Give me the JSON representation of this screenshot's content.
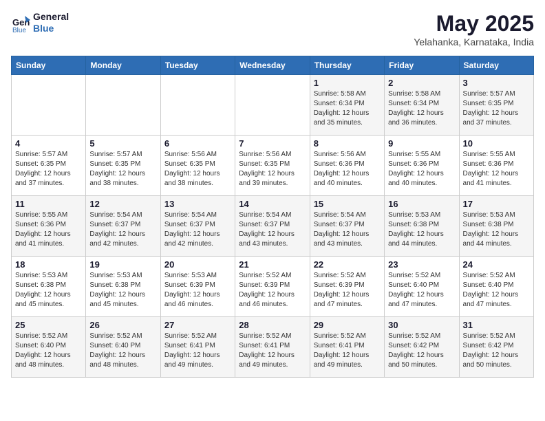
{
  "header": {
    "logo_line1": "General",
    "logo_line2": "Blue",
    "month_title": "May 2025",
    "subtitle": "Yelahanka, Karnataka, India"
  },
  "weekdays": [
    "Sunday",
    "Monday",
    "Tuesday",
    "Wednesday",
    "Thursday",
    "Friday",
    "Saturday"
  ],
  "weeks": [
    [
      {
        "day": "",
        "info": ""
      },
      {
        "day": "",
        "info": ""
      },
      {
        "day": "",
        "info": ""
      },
      {
        "day": "",
        "info": ""
      },
      {
        "day": "1",
        "info": "Sunrise: 5:58 AM\nSunset: 6:34 PM\nDaylight: 12 hours\nand 35 minutes."
      },
      {
        "day": "2",
        "info": "Sunrise: 5:58 AM\nSunset: 6:34 PM\nDaylight: 12 hours\nand 36 minutes."
      },
      {
        "day": "3",
        "info": "Sunrise: 5:57 AM\nSunset: 6:35 PM\nDaylight: 12 hours\nand 37 minutes."
      }
    ],
    [
      {
        "day": "4",
        "info": "Sunrise: 5:57 AM\nSunset: 6:35 PM\nDaylight: 12 hours\nand 37 minutes."
      },
      {
        "day": "5",
        "info": "Sunrise: 5:57 AM\nSunset: 6:35 PM\nDaylight: 12 hours\nand 38 minutes."
      },
      {
        "day": "6",
        "info": "Sunrise: 5:56 AM\nSunset: 6:35 PM\nDaylight: 12 hours\nand 38 minutes."
      },
      {
        "day": "7",
        "info": "Sunrise: 5:56 AM\nSunset: 6:35 PM\nDaylight: 12 hours\nand 39 minutes."
      },
      {
        "day": "8",
        "info": "Sunrise: 5:56 AM\nSunset: 6:36 PM\nDaylight: 12 hours\nand 40 minutes."
      },
      {
        "day": "9",
        "info": "Sunrise: 5:55 AM\nSunset: 6:36 PM\nDaylight: 12 hours\nand 40 minutes."
      },
      {
        "day": "10",
        "info": "Sunrise: 5:55 AM\nSunset: 6:36 PM\nDaylight: 12 hours\nand 41 minutes."
      }
    ],
    [
      {
        "day": "11",
        "info": "Sunrise: 5:55 AM\nSunset: 6:36 PM\nDaylight: 12 hours\nand 41 minutes."
      },
      {
        "day": "12",
        "info": "Sunrise: 5:54 AM\nSunset: 6:37 PM\nDaylight: 12 hours\nand 42 minutes."
      },
      {
        "day": "13",
        "info": "Sunrise: 5:54 AM\nSunset: 6:37 PM\nDaylight: 12 hours\nand 42 minutes."
      },
      {
        "day": "14",
        "info": "Sunrise: 5:54 AM\nSunset: 6:37 PM\nDaylight: 12 hours\nand 43 minutes."
      },
      {
        "day": "15",
        "info": "Sunrise: 5:54 AM\nSunset: 6:37 PM\nDaylight: 12 hours\nand 43 minutes."
      },
      {
        "day": "16",
        "info": "Sunrise: 5:53 AM\nSunset: 6:38 PM\nDaylight: 12 hours\nand 44 minutes."
      },
      {
        "day": "17",
        "info": "Sunrise: 5:53 AM\nSunset: 6:38 PM\nDaylight: 12 hours\nand 44 minutes."
      }
    ],
    [
      {
        "day": "18",
        "info": "Sunrise: 5:53 AM\nSunset: 6:38 PM\nDaylight: 12 hours\nand 45 minutes."
      },
      {
        "day": "19",
        "info": "Sunrise: 5:53 AM\nSunset: 6:38 PM\nDaylight: 12 hours\nand 45 minutes."
      },
      {
        "day": "20",
        "info": "Sunrise: 5:53 AM\nSunset: 6:39 PM\nDaylight: 12 hours\nand 46 minutes."
      },
      {
        "day": "21",
        "info": "Sunrise: 5:52 AM\nSunset: 6:39 PM\nDaylight: 12 hours\nand 46 minutes."
      },
      {
        "day": "22",
        "info": "Sunrise: 5:52 AM\nSunset: 6:39 PM\nDaylight: 12 hours\nand 47 minutes."
      },
      {
        "day": "23",
        "info": "Sunrise: 5:52 AM\nSunset: 6:40 PM\nDaylight: 12 hours\nand 47 minutes."
      },
      {
        "day": "24",
        "info": "Sunrise: 5:52 AM\nSunset: 6:40 PM\nDaylight: 12 hours\nand 47 minutes."
      }
    ],
    [
      {
        "day": "25",
        "info": "Sunrise: 5:52 AM\nSunset: 6:40 PM\nDaylight: 12 hours\nand 48 minutes."
      },
      {
        "day": "26",
        "info": "Sunrise: 5:52 AM\nSunset: 6:40 PM\nDaylight: 12 hours\nand 48 minutes."
      },
      {
        "day": "27",
        "info": "Sunrise: 5:52 AM\nSunset: 6:41 PM\nDaylight: 12 hours\nand 49 minutes."
      },
      {
        "day": "28",
        "info": "Sunrise: 5:52 AM\nSunset: 6:41 PM\nDaylight: 12 hours\nand 49 minutes."
      },
      {
        "day": "29",
        "info": "Sunrise: 5:52 AM\nSunset: 6:41 PM\nDaylight: 12 hours\nand 49 minutes."
      },
      {
        "day": "30",
        "info": "Sunrise: 5:52 AM\nSunset: 6:42 PM\nDaylight: 12 hours\nand 50 minutes."
      },
      {
        "day": "31",
        "info": "Sunrise: 5:52 AM\nSunset: 6:42 PM\nDaylight: 12 hours\nand 50 minutes."
      }
    ]
  ]
}
